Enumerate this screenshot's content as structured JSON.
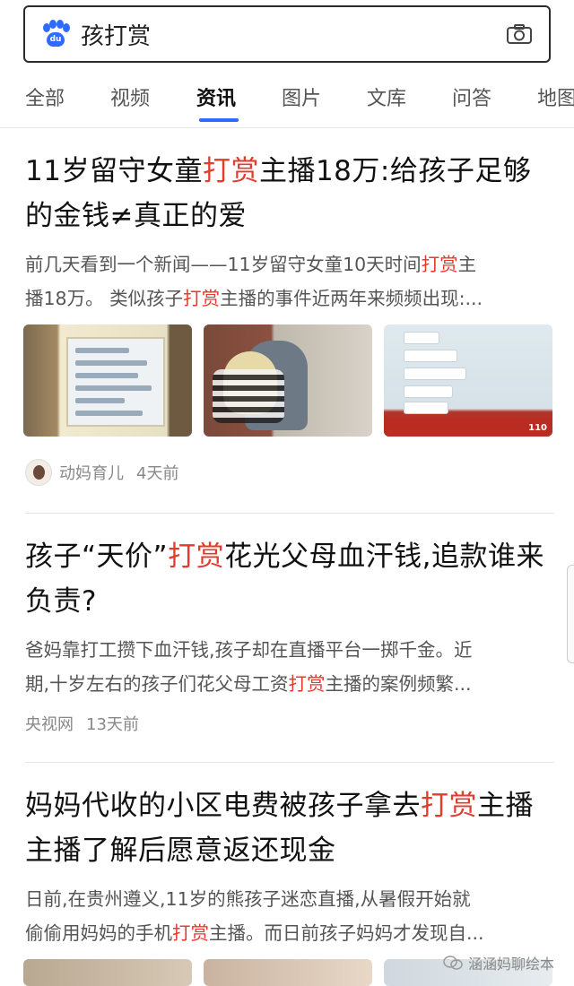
{
  "search": {
    "logo_text": "du",
    "query": "孩打赏"
  },
  "tabs": [
    {
      "label": "全部",
      "active": false
    },
    {
      "label": "视频",
      "active": false
    },
    {
      "label": "资讯",
      "active": true
    },
    {
      "label": "图片",
      "active": false
    },
    {
      "label": "文库",
      "active": false
    },
    {
      "label": "问答",
      "active": false
    },
    {
      "label": "地图",
      "active": false
    }
  ],
  "articles": [
    {
      "title_parts": [
        "11岁留守女童",
        "打赏",
        "主播18万:给孩子足够",
        "的金钱≠真正的爱"
      ],
      "snippet_parts": [
        "前几天看到一个新闻——11岁留守女童10天时间",
        "打赏",
        "主",
        "播18万。 类似孩子",
        "打赏",
        "主播的事件近两年来频频出现:..."
      ],
      "source": "动妈育儿",
      "time": "4天前"
    },
    {
      "title_parts": [
        "孩子“天价”",
        "打赏",
        "花光父母血汗钱,追款谁来",
        "负责?"
      ],
      "snippet_parts": [
        "爸妈靠打工攒下血汗钱,孩子却在直播平台一掷千金。近",
        "期,十岁左右的孩子们花父母工资",
        "打赏",
        "主播的案例频繁..."
      ],
      "source": "央视网",
      "time": "13天前"
    },
    {
      "title_parts": [
        "妈妈代收的小区电费被孩子拿去",
        "打赏",
        "主播",
        "主播了解后愿意返还现金"
      ],
      "snippet_parts": [
        "日前,在贵州遵义,11岁的熊孩子迷恋直播,从暑假开始就",
        "偷偷用妈妈的手机",
        "打赏",
        "主播。而日前孩子妈妈才发现自..."
      ]
    }
  ],
  "watermark": "涵涵妈聊绘本",
  "colors": {
    "highlight": "#e33b2d",
    "accent": "#2f6bff"
  }
}
